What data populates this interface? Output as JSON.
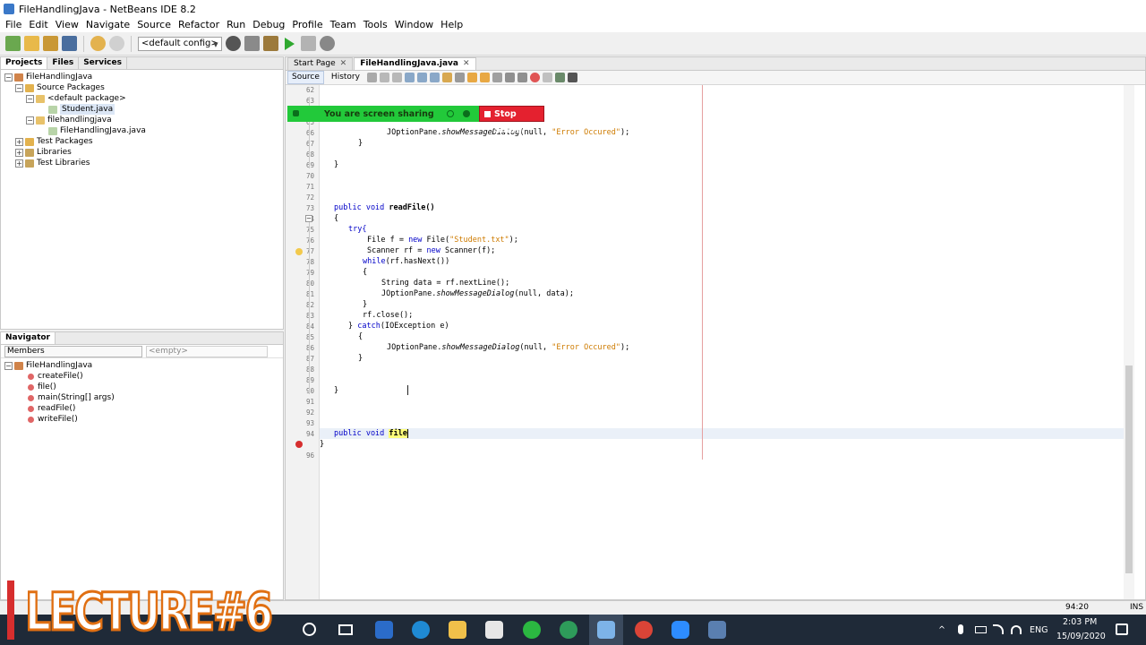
{
  "window": {
    "title": "FileHandlingJava - NetBeans IDE 8.2"
  },
  "menu": [
    "File",
    "Edit",
    "View",
    "Navigate",
    "Source",
    "Refactor",
    "Run",
    "Debug",
    "Profile",
    "Team",
    "Tools",
    "Window",
    "Help"
  ],
  "toolbar": {
    "config": "<default config>"
  },
  "projects": {
    "tabs": [
      "Projects",
      "Files",
      "Services"
    ],
    "tree": {
      "root": "FileHandlingJava",
      "source_packages": "Source Packages",
      "default_package": "<default package>",
      "student_file": "Student.java",
      "pkg": "filehandlingjava",
      "main_file": "FileHandlingJava.java",
      "test_packages": "Test Packages",
      "libraries": "Libraries",
      "test_libraries": "Test Libraries"
    }
  },
  "navigator": {
    "title": "Navigator",
    "filter": "Members",
    "filter2": "<empty>",
    "class_name": "FileHandlingJava",
    "members": [
      "createFile()",
      "file()",
      "main(String[] args)",
      "readFile()",
      "writeFile()"
    ]
  },
  "editor": {
    "tabs": [
      "Start Page",
      "FileHandlingJava.java"
    ],
    "modes": [
      "Source",
      "History"
    ],
    "lines": [
      "62",
      "63",
      "65",
      "66",
      "67",
      "68",
      "69",
      "70",
      "71",
      "72",
      "73",
      "74",
      "75",
      "76",
      "77",
      "78",
      "79",
      "80",
      "81",
      "82",
      "83",
      "84",
      "85",
      "86",
      "87",
      "88",
      "89",
      "90",
      "91",
      "92",
      "93",
      "94",
      "96"
    ],
    "code": {
      "l66a": "JOptionPane.",
      "l66b": "showMessageDialog",
      "l66c": "(null, ",
      "l66d": "\"Error Occured\"",
      "l66e": ");",
      "brace_close": "}",
      "brace_open": "{",
      "l73a": "public void ",
      "l73b": "readFile()",
      "l75": "try{",
      "l76a": "File f = ",
      "l76b": "new",
      "l76c": " File(",
      "l76d": "\"Student.txt\"",
      "l76e": ");",
      "l77a": "Scanner rf = ",
      "l77b": "new",
      "l77c": " Scanner(f);",
      "l78a": "while",
      "l78b": "(rf.hasNext())",
      "l80a": "String data = rf.nextLine();",
      "l81a": "JOptionPane.",
      "l81b": "showMessageDialog",
      "l81c": "(null, data);",
      "l83": "rf.close();",
      "l84a": "} ",
      "l84b": "catch",
      "l84c": "(IOException e)",
      "l94a": "public void ",
      "l94b": "file",
      "l96": "}"
    }
  },
  "share": {
    "label": "You are screen sharing",
    "stop": "Stop Share"
  },
  "status": {
    "position": "94:20",
    "mode": "INS"
  },
  "overlay": {
    "lecture": "LECTURE#6"
  },
  "taskbar": {
    "lang": "ENG",
    "time": "2:03 PM",
    "date": "15/09/2020"
  }
}
